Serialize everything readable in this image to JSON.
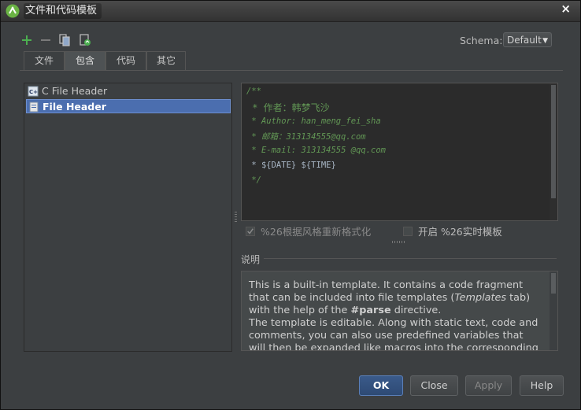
{
  "window": {
    "title": "文件和代码模板",
    "close_label": "×"
  },
  "toolbar": {
    "buttons": [
      "add-icon",
      "remove-icon",
      "copy-icon",
      "reset-icon"
    ]
  },
  "schema": {
    "label": "Schema:",
    "value": "Default"
  },
  "tabs": [
    {
      "label": "文件",
      "active": false
    },
    {
      "label": "包含",
      "active": true
    },
    {
      "label": "代码",
      "active": false
    },
    {
      "label": "其它",
      "active": false
    }
  ],
  "templates": [
    {
      "label": "C File Header",
      "selected": false
    },
    {
      "label": "File Header",
      "selected": true
    }
  ],
  "editor": {
    "lines": [
      "/**",
      " * 作者：韩梦飞沙",
      " * Author: han_meng_fei_sha",
      " * 邮箱：313134555@qq.com",
      " * E-mail: 313134555 @qq.com",
      " * ${DATE} ${TIME}",
      " */"
    ]
  },
  "options": {
    "reformat_label": "%26根据风格重新格式化",
    "reformat_checked": true,
    "live_template_label": "开启 %26实时模板",
    "live_template_checked": false
  },
  "description": {
    "label": "说明",
    "p1_a": "This is a built-in template. It contains a code fragment that can be included into file templates (",
    "p1_em": "Templates",
    "p1_b": " tab) with the help of the ",
    "p1_strong": "#parse",
    "p1_c": " directive.",
    "p2": "The template is editable. Along with static text, code and comments, you can also use predefined variables that will then be expanded like macros into the corresponding values."
  },
  "buttons": {
    "ok": "OK",
    "close": "Close",
    "apply": "Apply",
    "help": "Help"
  },
  "colors": {
    "accent": "#4b6eaf",
    "comment": "#629755",
    "add_icon": "#4caf50"
  }
}
